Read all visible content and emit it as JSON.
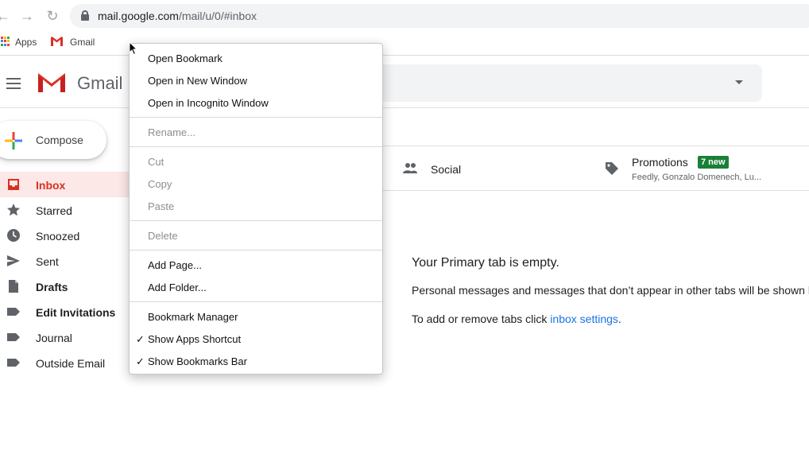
{
  "browser": {
    "url_host": "mail.google.com",
    "url_path": "/mail/u/0/#inbox",
    "bookmarks": [
      {
        "label": "Apps",
        "icon": "apps-grid-icon"
      },
      {
        "label": "Gmail",
        "icon": "gmail-icon"
      }
    ]
  },
  "header": {
    "brand": "Gmail"
  },
  "compose": {
    "label": "Compose"
  },
  "sidebar": {
    "items": [
      {
        "label": "Inbox",
        "icon": "inbox-icon"
      },
      {
        "label": "Starred",
        "icon": "star-icon"
      },
      {
        "label": "Snoozed",
        "icon": "clock-icon"
      },
      {
        "label": "Sent",
        "icon": "send-icon"
      },
      {
        "label": "Drafts",
        "icon": "draft-icon"
      },
      {
        "label": "Edit Invitations",
        "icon": "label-icon"
      },
      {
        "label": "Journal",
        "icon": "label-icon"
      },
      {
        "label": "Outside Email",
        "icon": "label-icon"
      }
    ]
  },
  "tabs": {
    "social": {
      "label": "Social",
      "icon": "people-icon"
    },
    "promotions": {
      "label": "Promotions",
      "badge": "7 new",
      "snippet": "Feedly, Gonzalo Domenech, Lu...",
      "icon": "tag-icon"
    }
  },
  "empty_state": {
    "title": "Your Primary tab is empty.",
    "text": "Personal messages and messages that don’t appear in other tabs will be shown h",
    "hint_prefix": "To add or remove tabs click ",
    "hint_link": "inbox settings",
    "hint_suffix": "."
  },
  "context_menu": {
    "groups": [
      [
        {
          "label": "Open Bookmark",
          "enabled": true
        },
        {
          "label": "Open in New Window",
          "enabled": true
        },
        {
          "label": "Open in Incognito Window",
          "enabled": true
        }
      ],
      [
        {
          "label": "Rename...",
          "enabled": false
        }
      ],
      [
        {
          "label": "Cut",
          "enabled": false
        },
        {
          "label": "Copy",
          "enabled": false
        },
        {
          "label": "Paste",
          "enabled": false
        }
      ],
      [
        {
          "label": "Delete",
          "enabled": false
        }
      ],
      [
        {
          "label": "Add Page...",
          "enabled": true
        },
        {
          "label": "Add Folder...",
          "enabled": true
        }
      ],
      [
        {
          "label": "Bookmark Manager",
          "enabled": true
        },
        {
          "label": "Show Apps Shortcut",
          "enabled": true,
          "checked": true
        },
        {
          "label": "Show Bookmarks Bar",
          "enabled": true,
          "checked": true
        }
      ]
    ]
  },
  "colors": {
    "gmail_red": "#d93025",
    "inbox_highlight": "#fce8e6",
    "badge_green": "#188038",
    "link_blue": "#1a73e8"
  }
}
